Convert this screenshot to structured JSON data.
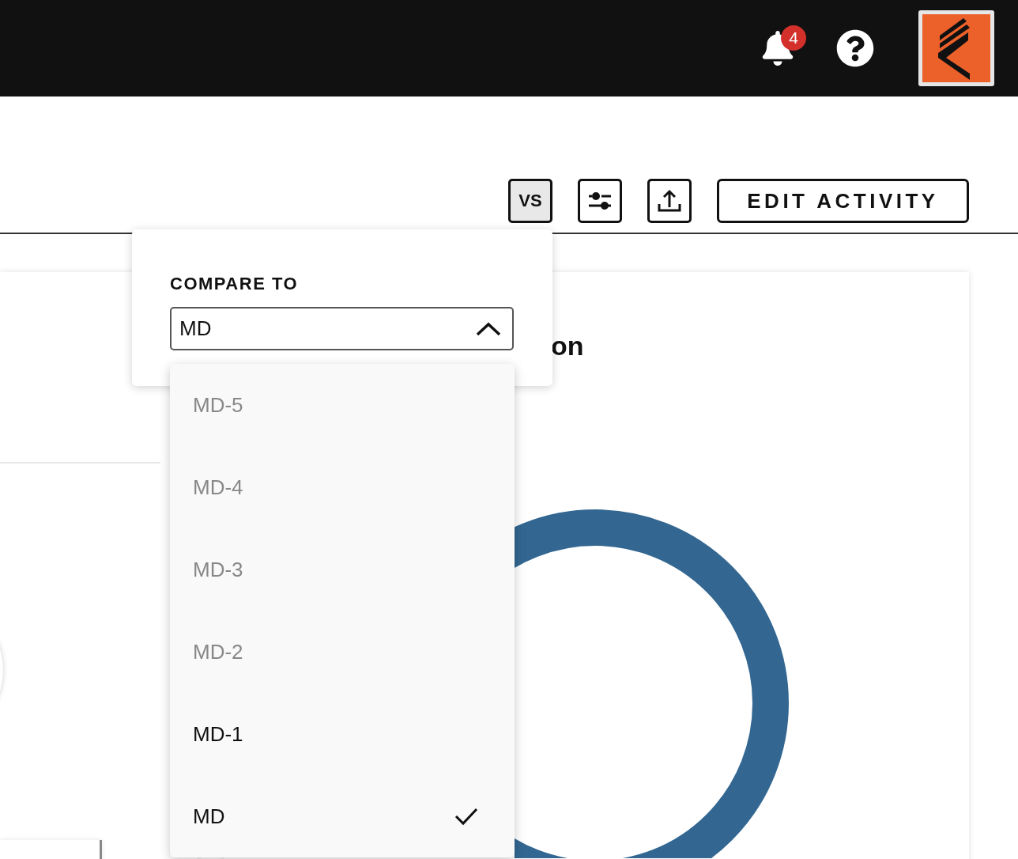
{
  "header": {
    "notifications": {
      "count": "4"
    }
  },
  "toolbar": {
    "compare_button": {
      "label": "VS",
      "active": true
    },
    "edit_button": {
      "label": "EDIT ACTIVITY"
    }
  },
  "card": {
    "title": "on"
  },
  "compare_popover": {
    "label": "COMPARE TO",
    "value": "MD",
    "expanded": true,
    "options": [
      {
        "label": "MD-5",
        "disabled": true,
        "selected": false
      },
      {
        "label": "MD-4",
        "disabled": true,
        "selected": false
      },
      {
        "label": "MD-3",
        "disabled": true,
        "selected": false
      },
      {
        "label": "MD-2",
        "disabled": true,
        "selected": false
      },
      {
        "label": "MD-1",
        "disabled": false,
        "selected": false
      },
      {
        "label": "MD",
        "disabled": false,
        "selected": true
      }
    ]
  }
}
